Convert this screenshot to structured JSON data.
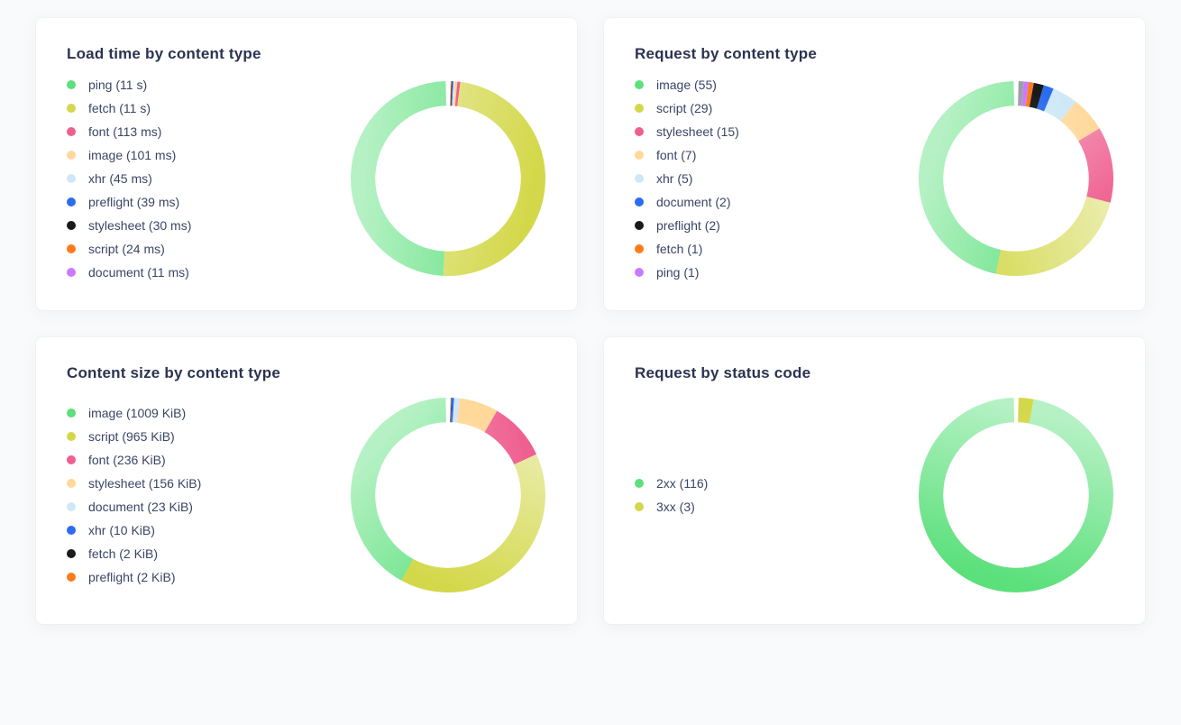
{
  "palette": {
    "green": "#5be07b",
    "olive": "#d3d84a",
    "pink": "#ef5f8f",
    "peach": "#ffd89a",
    "ice": "#cfe8f7",
    "blue": "#2b6cf0",
    "black": "#1a1a1a",
    "orange": "#ff7a1a",
    "violet": "#c97bff",
    "grey": "#9aa0a6"
  },
  "cards": [
    {
      "id": "load-time",
      "title": "Load time by content type",
      "series": [
        {
          "label": "ping (11 s)",
          "color": "green",
          "value": 11000
        },
        {
          "label": "fetch (11 s)",
          "color": "olive",
          "value": 11000
        },
        {
          "label": "font (113 ms)",
          "color": "pink",
          "value": 113
        },
        {
          "label": "image (101 ms)",
          "color": "peach",
          "value": 101
        },
        {
          "label": "xhr (45 ms)",
          "color": "ice",
          "value": 45
        },
        {
          "label": "preflight (39 ms)",
          "color": "blue",
          "value": 39
        },
        {
          "label": "stylesheet (30 ms)",
          "color": "black",
          "value": 30
        },
        {
          "label": "script (24 ms)",
          "color": "orange",
          "value": 24
        },
        {
          "label": "document (11 ms)",
          "color": "violet",
          "value": 11
        }
      ]
    },
    {
      "id": "request-count",
      "title": "Request by content type",
      "series": [
        {
          "label": "image (55)",
          "color": "green",
          "value": 55
        },
        {
          "label": "script (29)",
          "color": "olive",
          "value": 29
        },
        {
          "label": "stylesheet (15)",
          "color": "pink",
          "value": 15
        },
        {
          "label": "font (7)",
          "color": "peach",
          "value": 7
        },
        {
          "label": "xhr (5)",
          "color": "ice",
          "value": 5
        },
        {
          "label": "document (2)",
          "color": "blue",
          "value": 2
        },
        {
          "label": "preflight (2)",
          "color": "black",
          "value": 2
        },
        {
          "label": "fetch (1)",
          "color": "orange",
          "value": 1
        },
        {
          "label": "ping (1)",
          "color": "violet",
          "value": 1
        }
      ],
      "extra_slices": [
        {
          "color": "grey",
          "value": 1
        }
      ]
    },
    {
      "id": "content-size",
      "title": "Content size by content type",
      "series": [
        {
          "label": "image (1009 KiB)",
          "color": "green",
          "value": 1009
        },
        {
          "label": "script (965 KiB)",
          "color": "olive",
          "value": 965
        },
        {
          "label": "font (236 KiB)",
          "color": "pink",
          "value": 236
        },
        {
          "label": "stylesheet (156 KiB)",
          "color": "peach",
          "value": 156
        },
        {
          "label": "document (23 KiB)",
          "color": "ice",
          "value": 23
        },
        {
          "label": "xhr (10 KiB)",
          "color": "blue",
          "value": 10
        },
        {
          "label": "fetch (2 KiB)",
          "color": "black",
          "value": 2
        },
        {
          "label": "preflight (2 KiB)",
          "color": "orange",
          "value": 2
        }
      ]
    },
    {
      "id": "status-code",
      "title": "Request by status code",
      "legend_center": true,
      "series": [
        {
          "label": "2xx (116)",
          "color": "green",
          "value": 116
        },
        {
          "label": "3xx (3)",
          "color": "olive",
          "value": 3
        }
      ]
    }
  ],
  "chart_data": [
    {
      "type": "pie",
      "title": "Load time by content type",
      "categories": [
        "ping",
        "fetch",
        "font",
        "image",
        "xhr",
        "preflight",
        "stylesheet",
        "script",
        "document"
      ],
      "values_ms": [
        11000,
        11000,
        113,
        101,
        45,
        39,
        30,
        24,
        11
      ]
    },
    {
      "type": "pie",
      "title": "Request by content type",
      "categories": [
        "image",
        "script",
        "stylesheet",
        "font",
        "xhr",
        "document",
        "preflight",
        "fetch",
        "ping"
      ],
      "values": [
        55,
        29,
        15,
        7,
        5,
        2,
        2,
        1,
        1
      ]
    },
    {
      "type": "pie",
      "title": "Content size by content type",
      "categories": [
        "image",
        "script",
        "font",
        "stylesheet",
        "document",
        "xhr",
        "fetch",
        "preflight"
      ],
      "values_kib": [
        1009,
        965,
        236,
        156,
        23,
        10,
        2,
        2
      ]
    },
    {
      "type": "pie",
      "title": "Request by status code",
      "categories": [
        "2xx",
        "3xx"
      ],
      "values": [
        116,
        3
      ]
    }
  ]
}
